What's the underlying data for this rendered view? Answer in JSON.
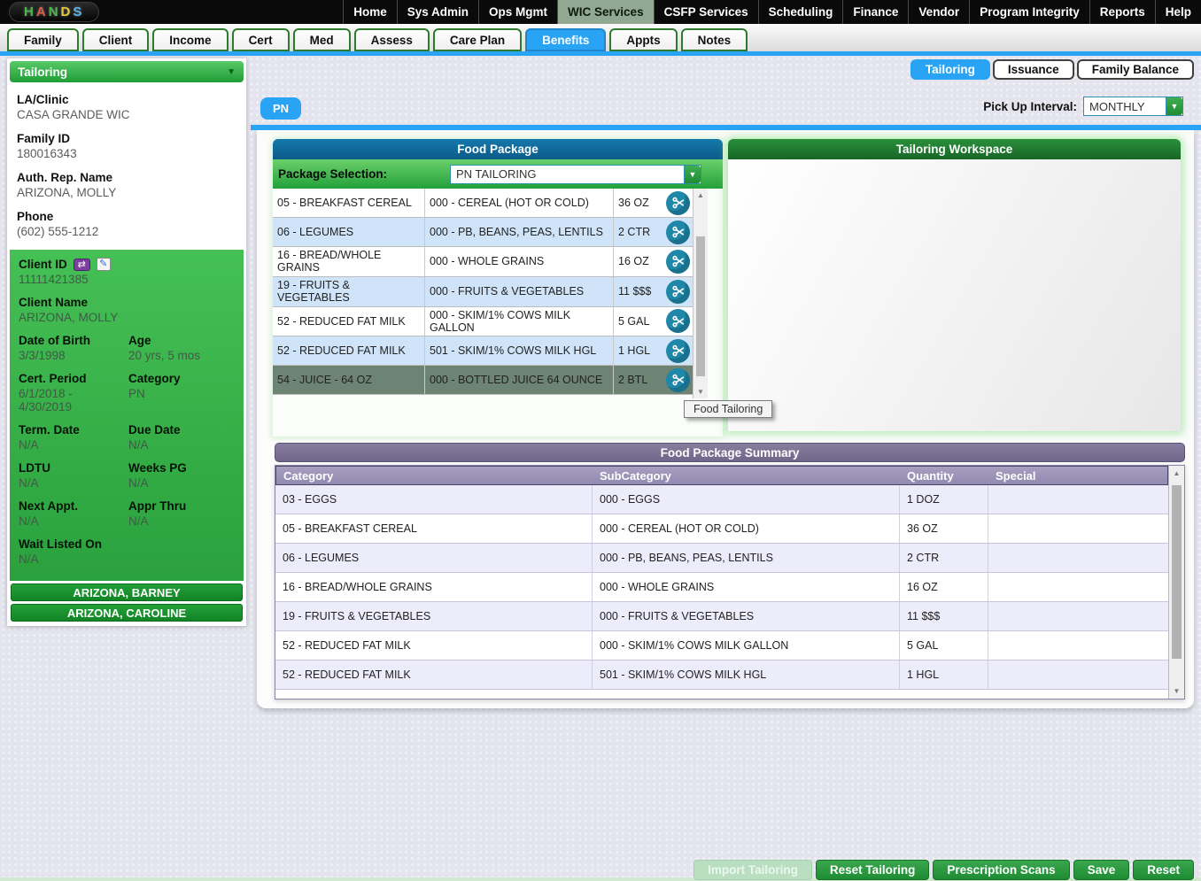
{
  "logo": {
    "letters": [
      {
        "ch": "H",
        "color": "#4cb84c"
      },
      {
        "ch": "A",
        "color": "#e05a4e"
      },
      {
        "ch": "N",
        "color": "#4cb84c"
      },
      {
        "ch": "D",
        "color": "#e8c93e"
      },
      {
        "ch": "S",
        "color": "#57b7e8"
      }
    ]
  },
  "top_nav": {
    "items": [
      {
        "label": "Home"
      },
      {
        "label": "Sys Admin"
      },
      {
        "label": "Ops Mgmt"
      },
      {
        "label": "WIC Services",
        "active": true
      },
      {
        "label": "CSFP Services"
      },
      {
        "label": "Scheduling"
      },
      {
        "label": "Finance"
      },
      {
        "label": "Vendor"
      },
      {
        "label": "Program Integrity"
      },
      {
        "label": "Reports"
      },
      {
        "label": "Help"
      }
    ]
  },
  "module_tabs": {
    "items": [
      {
        "label": "Family"
      },
      {
        "label": "Client"
      },
      {
        "label": "Income"
      },
      {
        "label": "Cert"
      },
      {
        "label": "Med"
      },
      {
        "label": "Assess"
      },
      {
        "label": "Care Plan"
      },
      {
        "label": "Benefits",
        "active": true
      },
      {
        "label": "Appts"
      },
      {
        "label": "Notes"
      }
    ]
  },
  "sidebar": {
    "section_title": "Tailoring",
    "info_fields": [
      {
        "label": "LA/Clinic",
        "value": "CASA GRANDE WIC"
      },
      {
        "label": "Family ID",
        "value": "180016343"
      },
      {
        "label": "Auth. Rep. Name",
        "value": "ARIZONA, MOLLY"
      },
      {
        "label": "Phone",
        "value": "(602) 555-1212"
      }
    ],
    "client_id": {
      "label": "Client ID",
      "value": "11111421385"
    },
    "client_name": {
      "label": "Client Name",
      "value": "ARIZONA, MOLLY"
    },
    "detail_fields": [
      {
        "label": "Date of Birth",
        "value": "3/3/1998"
      },
      {
        "label": "Age",
        "value": "20 yrs, 5 mos"
      },
      {
        "label": "Cert. Period",
        "value": "6/1/2018 - 4/30/2019"
      },
      {
        "label": "Category",
        "value": "PN"
      },
      {
        "label": "Term. Date",
        "value": "N/A"
      },
      {
        "label": "Due Date",
        "value": "N/A"
      },
      {
        "label": "LDTU",
        "value": "N/A"
      },
      {
        "label": "Weeks PG",
        "value": "N/A"
      },
      {
        "label": "Next Appt.",
        "value": "N/A"
      },
      {
        "label": "Appr Thru",
        "value": "N/A"
      },
      {
        "label": "Wait Listed On",
        "value": "N/A"
      }
    ],
    "family_members": [
      {
        "name": "ARIZONA, BARNEY"
      },
      {
        "name": "ARIZONA, CAROLINE"
      }
    ]
  },
  "view_tabs": {
    "items": [
      {
        "label": "Tailoring",
        "active": true
      },
      {
        "label": "Issuance"
      },
      {
        "label": "Family Balance"
      }
    ]
  },
  "toolbar": {
    "category_badge": "PN",
    "pickup_label": "Pick Up Interval:",
    "pickup_value": "MONTHLY"
  },
  "food_package": {
    "title": "Food Package",
    "selection_label": "Package Selection:",
    "selection_value": "PN TAILORING",
    "tooltip": "Food Tailoring",
    "rows": [
      {
        "category": "05 - BREAKFAST CEREAL",
        "subcategory": "000 - CEREAL (HOT OR COLD)",
        "quantity": "36 OZ"
      },
      {
        "category": "06 - LEGUMES",
        "subcategory": "000 - PB, BEANS, PEAS, LENTILS",
        "quantity": "2 CTR"
      },
      {
        "category": "16 - BREAD/WHOLE GRAINS",
        "subcategory": "000 - WHOLE GRAINS",
        "quantity": "16 OZ"
      },
      {
        "category": "19 - FRUITS & VEGETABLES",
        "subcategory": "000 - FRUITS & VEGETABLES",
        "quantity": "11 $$$"
      },
      {
        "category": "52 - REDUCED FAT MILK",
        "subcategory": "000 - SKIM/1% COWS MILK GALLON",
        "quantity": "5 GAL"
      },
      {
        "category": "52 - REDUCED FAT MILK",
        "subcategory": "501 - SKIM/1% COWS MILK HGL",
        "quantity": "1 HGL"
      },
      {
        "category": "54 - JUICE - 64 OZ",
        "subcategory": "000 - BOTTLED JUICE 64 OUNCE",
        "quantity": "2 BTL",
        "selected": true
      }
    ]
  },
  "workspace": {
    "title": "Tailoring Workspace"
  },
  "summary": {
    "title": "Food Package Summary",
    "columns": [
      {
        "label": "Category"
      },
      {
        "label": "SubCategory"
      },
      {
        "label": "Quantity"
      },
      {
        "label": "Special"
      }
    ],
    "rows": [
      {
        "category": "03 - EGGS",
        "subcategory": "000 - EGGS",
        "quantity": "1 DOZ",
        "special": ""
      },
      {
        "category": "05 - BREAKFAST CEREAL",
        "subcategory": "000 - CEREAL (HOT OR COLD)",
        "quantity": "36 OZ",
        "special": ""
      },
      {
        "category": "06 - LEGUMES",
        "subcategory": "000 - PB, BEANS, PEAS, LENTILS",
        "quantity": "2 CTR",
        "special": ""
      },
      {
        "category": "16 - BREAD/WHOLE GRAINS",
        "subcategory": "000 - WHOLE GRAINS",
        "quantity": "16 OZ",
        "special": ""
      },
      {
        "category": "19 - FRUITS & VEGETABLES",
        "subcategory": "000 - FRUITS & VEGETABLES",
        "quantity": "11 $$$",
        "special": ""
      },
      {
        "category": "52 - REDUCED FAT MILK",
        "subcategory": "000 - SKIM/1% COWS MILK GALLON",
        "quantity": "5 GAL",
        "special": ""
      },
      {
        "category": "52 - REDUCED FAT MILK",
        "subcategory": "501 - SKIM/1% COWS MILK HGL",
        "quantity": "1 HGL",
        "special": ""
      }
    ]
  },
  "footer": {
    "buttons": [
      {
        "label": "Import Tailoring",
        "disabled": true
      },
      {
        "label": "Reset Tailoring"
      },
      {
        "label": "Prescription Scans"
      },
      {
        "label": "Save"
      },
      {
        "label": "Reset"
      }
    ]
  },
  "icons": {
    "chevron_down": "▼",
    "arrow_up": "▲",
    "arrow_down": "▼",
    "swap": "⇄",
    "edit": "✎"
  },
  "colors": {
    "accent_blue": "#29a3f4",
    "nav_active_green": "#91a892",
    "panel_header_blue": "#0e6493",
    "workspace_green": "#1e7a2e",
    "button_green": "#2e9e3e",
    "summary_purple": "#786f93",
    "summary_subheader_purple": "#9a92b4",
    "row_alt_blue": "#cfe4f8",
    "row_selected_sage": "#6d8374",
    "row_alt_lavender": "#edecfa",
    "scissors_teal": "#1f87a8"
  }
}
